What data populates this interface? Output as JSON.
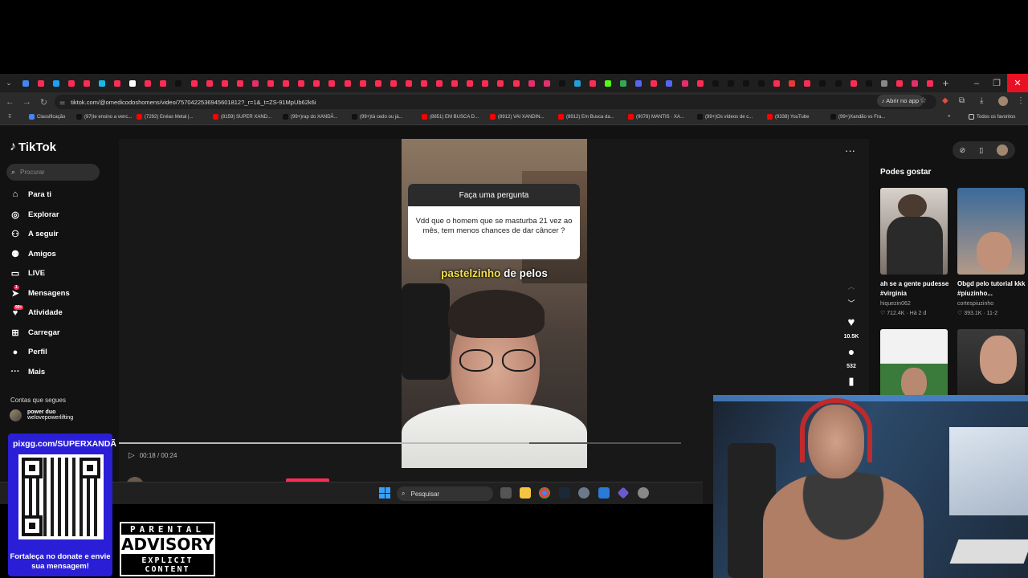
{
  "browser": {
    "url": "tiktok.com/@omedicodoshomens/video/7570422536945601812?_r=1&_t=ZS-91MpUb62k6i",
    "open_in_app": "Abrir no app",
    "tab_colors": [
      "#4285f4",
      "#fe2c55",
      "#1da1f2",
      "#fe2c55",
      "#fe2c55",
      "#1ab7ea",
      "#fe2c55",
      "#ffffff",
      "#fe2c55",
      "#fe2c55",
      "#111111",
      "#fe2c55",
      "#fe2c55",
      "#fe2c55",
      "#fe2c55",
      "#e1306c",
      "#fe2c55",
      "#fe2c55",
      "#fe2c55",
      "#fe2c55",
      "#fe2c55",
      "#fe2c55",
      "#fe2c55",
      "#fe2c55",
      "#fe2c55",
      "#fe2c55",
      "#fe2c55",
      "#fe2c55",
      "#fe2c55",
      "#fe2c55",
      "#fe2c55",
      "#fe2c55",
      "#fe2c55",
      "#e1306c",
      "#e1306c",
      "#111111",
      "#229ed9",
      "#fe2c55",
      "#53fc18",
      "#34a853",
      "#5865f2",
      "#fe2c55",
      "#5865f2",
      "#e1306c",
      "#fe2c55",
      "#111111",
      "#111111",
      "#111111",
      "#111111",
      "#fe2c55",
      "#e53935",
      "#fe2c55",
      "#111111",
      "#111111",
      "#fe2c55",
      "#111111",
      "#888888",
      "#fe2c55",
      "#e1306c",
      "#fe2c55"
    ],
    "bookmarks": [
      {
        "label": "Classificação",
        "color": "#4285f4"
      },
      {
        "label": "(97)Ie ensino a venc...",
        "color": "#111111"
      },
      {
        "label": "(7292) Enéas Metal |...",
        "color": "#ff0000"
      },
      {
        "label": "(8159) SUPER XAND...",
        "color": "#ff0000"
      },
      {
        "label": "(99+)rap do XANDÃ...",
        "color": "#111111"
      },
      {
        "label": "(99+)tá cedo ou já...",
        "color": "#111111"
      },
      {
        "label": "(8851) EM BUSCA D...",
        "color": "#ff0000"
      },
      {
        "label": "(8912) VAI XANDIN...",
        "color": "#ff0000"
      },
      {
        "label": "(8912) Em Busca da...",
        "color": "#ff0000"
      },
      {
        "label": "(9078) MANTIS · XA...",
        "color": "#ff0000"
      },
      {
        "label": "(99+)Os vídeos de c...",
        "color": "#111111"
      },
      {
        "label": "(9338) YouTube",
        "color": "#ff0000"
      },
      {
        "label": "(99+)Xandão vs Fra...",
        "color": "#111111"
      }
    ],
    "all_favorites": "Todos os favoritos"
  },
  "tiktok": {
    "brand": "TikTok",
    "search_placeholder": "Procurar",
    "nav": [
      {
        "label": "Para ti",
        "icon": "home-icon",
        "glyph": "⌂"
      },
      {
        "label": "Explorar",
        "icon": "compass-icon",
        "glyph": "◎"
      },
      {
        "label": "A seguir",
        "icon": "following-icon",
        "glyph": "⚇"
      },
      {
        "label": "Amigos",
        "icon": "friends-icon",
        "glyph": "⚉"
      },
      {
        "label": "LIVE",
        "icon": "live-icon",
        "glyph": "▭"
      },
      {
        "label": "Mensagens",
        "icon": "messages-icon",
        "glyph": "➤",
        "badge": "1"
      },
      {
        "label": "Atividade",
        "icon": "activity-icon",
        "glyph": "♥",
        "badge": "99+"
      },
      {
        "label": "Carregar",
        "icon": "upload-icon",
        "glyph": "⊞"
      },
      {
        "label": "Perfil",
        "icon": "profile-icon",
        "glyph": "●"
      },
      {
        "label": "Mais",
        "icon": "more-icon",
        "glyph": "···"
      }
    ],
    "following_title": "Contas que segues",
    "following": [
      {
        "name": "power duo",
        "handle": "welovepowerlifting"
      }
    ],
    "video": {
      "question_title": "Faça uma pergunta",
      "question_text": "Vdd que o homem que se masturba 21 vez ao mês,  tem menos chances de dar câncer ?",
      "caption_highlight": "pastelzinho",
      "caption_rest": " de pelos",
      "time": "00:18 / 00:24",
      "progress": 0.73,
      "author": "omedicodoshomens",
      "likes": "10.5K",
      "comments": "532"
    },
    "suggestions_title": "Podes gostar",
    "suggestions": [
      {
        "title": "ah se a gente pudesse #virginia",
        "author": "hiquezin062",
        "likes": "712.4K",
        "age": "Há 2 d"
      },
      {
        "title": "Obgd pelo tutorial kkk #piuzinho...",
        "author": "cortespiuzinho",
        "likes": "393.1K",
        "age": "11-2"
      },
      {
        "title": "",
        "author": "",
        "likes": "",
        "age": ""
      },
      {
        "title": "",
        "author": "",
        "likes": "",
        "age": ""
      }
    ]
  },
  "taskbar": {
    "search": "Pesquisar"
  },
  "overlays": {
    "pix_url": "pixgg.com/SUPERXANDÃ",
    "pix_message": "Fortaleça no donate e envie sua mensagem!",
    "advisory_line1": "PARENTAL",
    "advisory_line2": "ADVISORY",
    "advisory_line3": "EXPLICIT CONTENT"
  }
}
